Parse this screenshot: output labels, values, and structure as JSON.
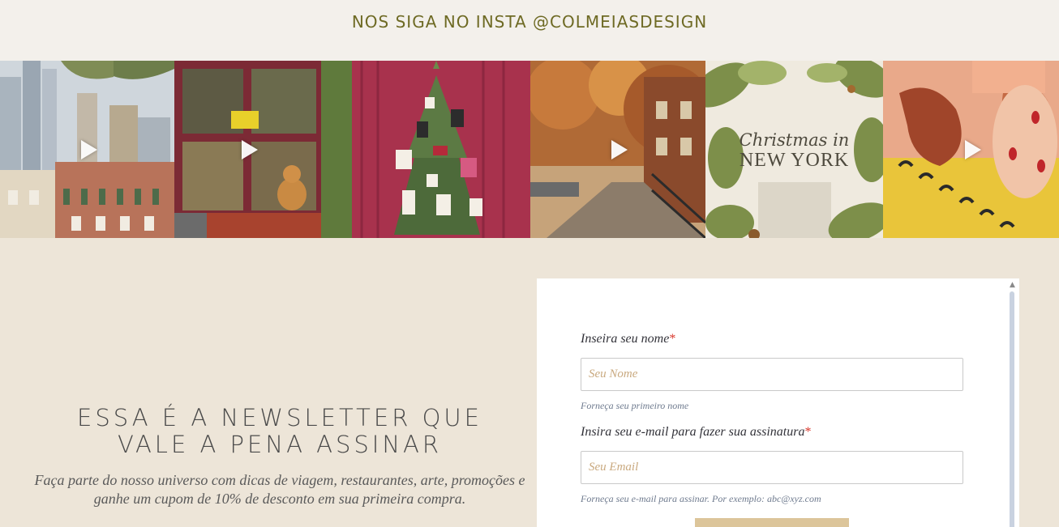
{
  "insta": {
    "heading": "NOS SIGA NO INSTA @COLMEIASDESIGN"
  },
  "feed": {
    "tiles": [
      {
        "name": "city-illustration",
        "video": true
      },
      {
        "name": "window-cat",
        "video": true
      },
      {
        "name": "christmas-tree-gift-guide",
        "video": false
      },
      {
        "name": "autumn-street",
        "video": true
      },
      {
        "name": "christmas-in-new-york",
        "video": false,
        "title_line1": "Christmas in",
        "title_line2": "NEW YORK"
      },
      {
        "name": "stamps-notebook",
        "video": true
      }
    ]
  },
  "newsletter": {
    "headline_line1": "ESSA É A NEWSLETTER QUE",
    "headline_line2": "VALE A PENA ASSINAR",
    "description": "Faça parte do nosso universo com dicas de viagem, restaurantes, arte, promoções e ganhe um cupom de 10% de desconto em sua primeira compra."
  },
  "form": {
    "name_label": "Inseira seu nome",
    "name_placeholder": "Seu Nome",
    "name_help": "Forneça seu primeiro nome",
    "email_label": "Insira seu e-mail para fazer sua assinatura",
    "email_placeholder": "Seu Email",
    "email_help": "Forneça seu e-mail para assinar. Por exemplo: abc@xyz.com",
    "required_mark": "*"
  },
  "colors": {
    "header_bg": "#f3f0eb",
    "page_bg": "#ede5d8",
    "heading_text": "#6e6a24",
    "required": "#d9382c",
    "placeholder": "#c9a97f",
    "button": "#dcc59a"
  }
}
